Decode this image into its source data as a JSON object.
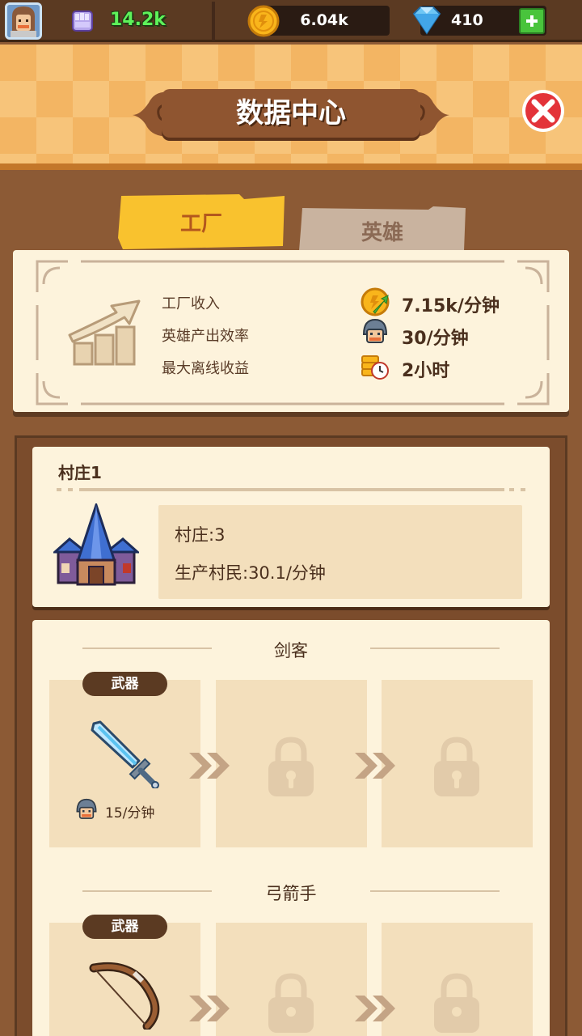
{
  "topbar": {
    "power_value": "14.2k",
    "coins_value": "6.04k",
    "gems_value": "410",
    "icons": [
      "avatar",
      "power-fist-icon",
      "coin-icon",
      "gem-icon",
      "plus-icon"
    ]
  },
  "header": {
    "title": "数据中心",
    "close_icon": "close-icon"
  },
  "tabs": [
    {
      "label": "工厂",
      "active": true
    },
    {
      "label": "英雄",
      "active": false
    }
  ],
  "stats": {
    "rows": [
      {
        "label": "工厂收入",
        "value": "7.15k/分钟",
        "icon": "coin-arrow-icon"
      },
      {
        "label": "英雄产出效率",
        "value": "30/分钟",
        "icon": "hero-head-icon"
      },
      {
        "label": "最大离线收益",
        "value": "2小时",
        "icon": "coin-timer-icon"
      }
    ]
  },
  "village": {
    "name": "村庄1",
    "level_line": "村庄:3",
    "production_line": "生产村民:30.1/分钟"
  },
  "heroes": [
    {
      "name": "剑客",
      "weapon_badge": "武器",
      "rate": "15/分钟",
      "weapon_icon": "sword-icon"
    },
    {
      "name": "弓箭手",
      "weapon_badge": "武器",
      "weapon_icon": "bow-icon"
    }
  ],
  "colors": {
    "background": "#8c5a35",
    "card": "#fdf3dc",
    "active_tab": "#f9c22e",
    "inactive_tab": "#c9b39f",
    "power_text": "#5ef25a"
  }
}
